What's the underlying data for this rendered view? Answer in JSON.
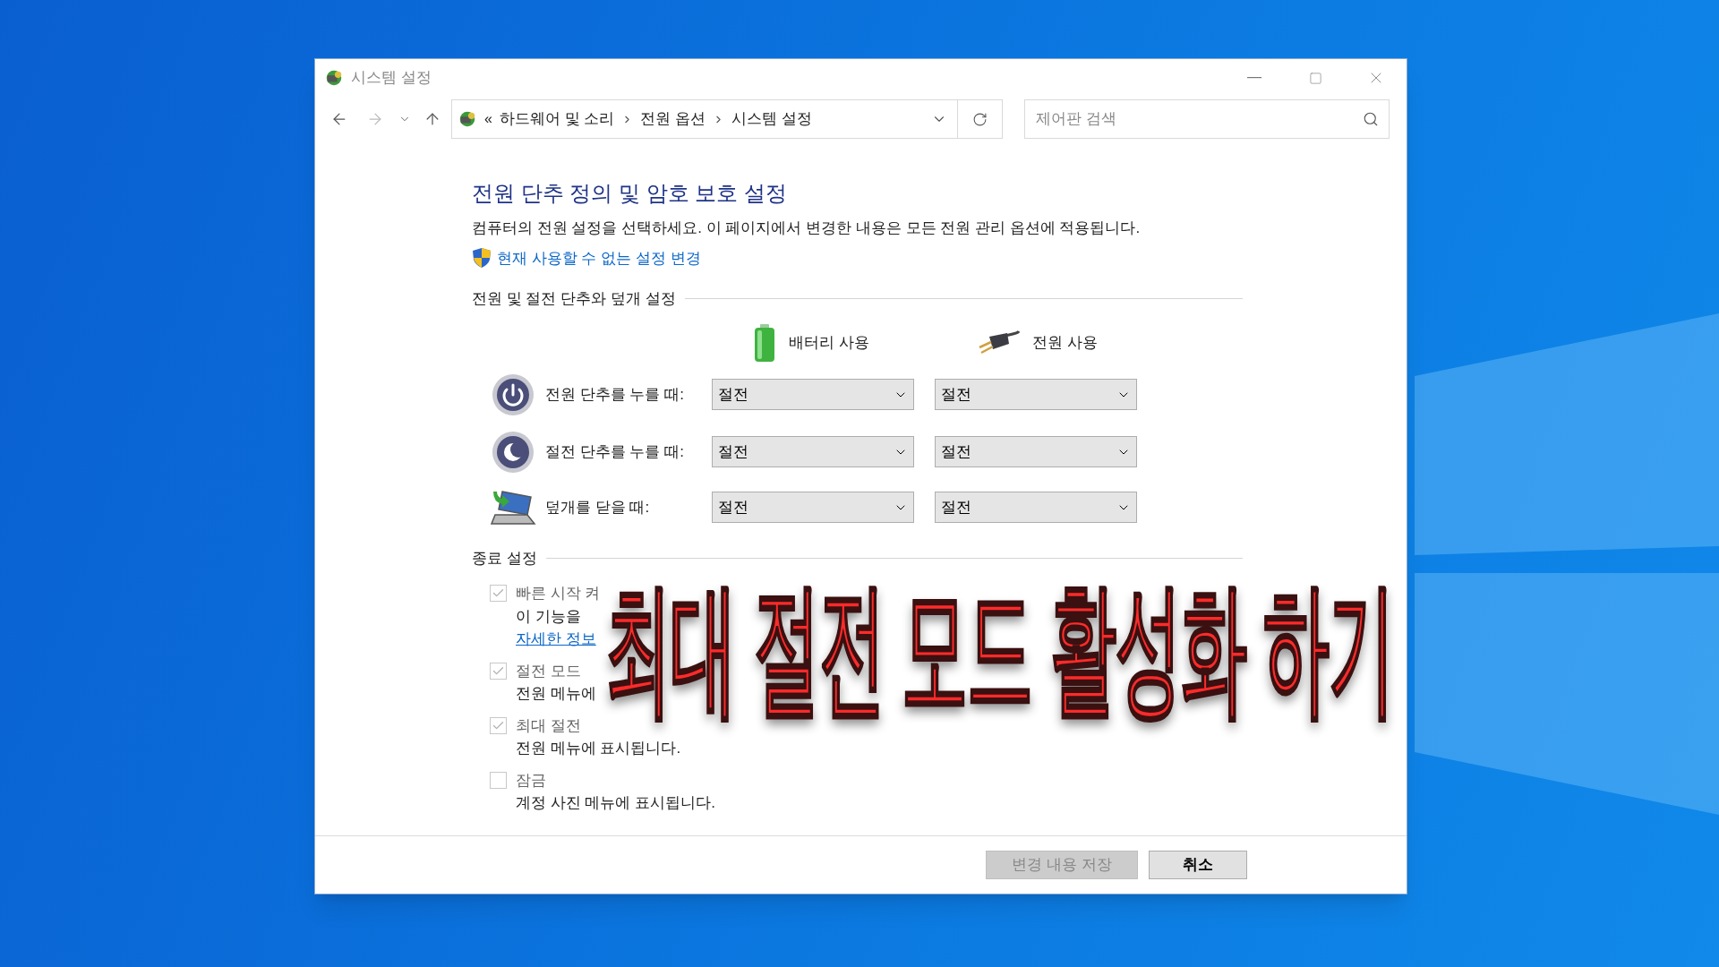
{
  "window": {
    "title": "시스템 설정"
  },
  "address_bar": {
    "prefix": "«",
    "path": [
      "하드웨어 및 소리",
      "전원 옵션",
      "시스템 설정"
    ]
  },
  "search": {
    "placeholder": "제어판 검색"
  },
  "heading": "전원 단추 정의 및 암호 보호 설정",
  "description": "컴퓨터의 전원 설정을 선택하세요. 이 페이지에서 변경한 내용은 모든 전원 관리 옵션에 적용됩니다.",
  "admin_link": "현재 사용할 수 없는 설정 변경",
  "power_section": {
    "title": "전원 및 절전 단추와 덮개 설정",
    "columns": [
      {
        "kind": "battery",
        "label": "배터리 사용"
      },
      {
        "kind": "plug",
        "label": "전원 사용"
      }
    ],
    "rows": [
      {
        "kind": "power",
        "label": "전원 단추를 누를 때:",
        "values": [
          "절전",
          "절전"
        ]
      },
      {
        "kind": "sleep",
        "label": "절전 단추를 누를 때:",
        "values": [
          "절전",
          "절전"
        ]
      },
      {
        "kind": "lid",
        "label": "덮개를 닫을 때:",
        "values": [
          "절전",
          "절전"
        ]
      }
    ]
  },
  "shutdown_section": {
    "title": "종료 설정",
    "options": [
      {
        "label": "빠른 시작 켜",
        "checked": true,
        "disabled": true,
        "description": "이 기능을",
        "link": "자세한 정보"
      },
      {
        "label": "절전 모드",
        "checked": true,
        "disabled": true,
        "description": "전원 메뉴에"
      },
      {
        "label": "최대 절전",
        "checked": true,
        "disabled": true,
        "description": "전원 메뉴에 표시됩니다."
      },
      {
        "label": "잠금",
        "checked": false,
        "disabled": true,
        "description": "계정 사진 메뉴에 표시됩니다."
      }
    ]
  },
  "buttons": [
    {
      "label": "변경 내용 저장",
      "disabled": true
    },
    {
      "label": "취소",
      "disabled": false
    }
  ],
  "overlay_caption": "최대 절전 모드 활성화 하기"
}
